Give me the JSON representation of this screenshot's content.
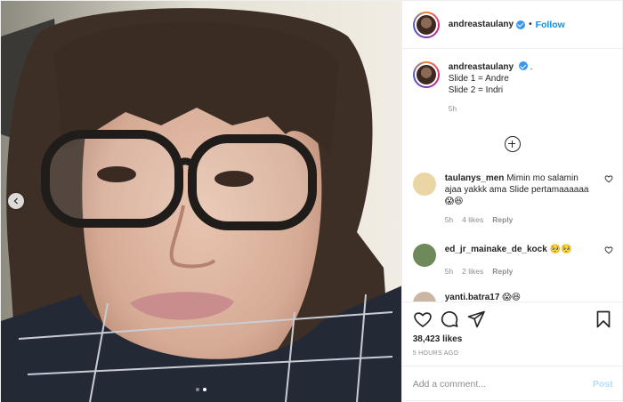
{
  "author": {
    "username": "andreastaulany",
    "verified": true,
    "follow_label": "Follow",
    "separator": "•"
  },
  "caption": {
    "username": "andreastaulany",
    "text_after_user": ".",
    "lines": [
      "Slide 1 = Andre",
      "Slide 2 = Indri"
    ],
    "time": "5h"
  },
  "comments": [
    {
      "username": "taulanys_men",
      "text": "Mimin mo salamin ajaa yakkk ama Slide pertamaaaaaa😱😆",
      "time": "5h",
      "likes": "4 likes",
      "reply_label": "Reply",
      "avatar_color": "#e9d6a4"
    },
    {
      "username": "ed_jr_mainake_de_kock",
      "text": "🥺🥺",
      "time": "5h",
      "likes": "2 likes",
      "reply_label": "Reply",
      "avatar_color": "#6f8a5a"
    },
    {
      "username": "yanti.batra17",
      "text": "😱😆",
      "avatar_color": "#c9b7a3"
    }
  ],
  "actions": {
    "like_icon": "heart-icon",
    "comment_icon": "comment-icon",
    "share_icon": "share-icon",
    "save_icon": "bookmark-icon",
    "likes_count": "38,423 likes",
    "timestamp": "5 HOURS AGO"
  },
  "composer": {
    "placeholder": "Add a comment...",
    "post_label": "Post"
  },
  "carousel": {
    "slide_count": 2,
    "active_slide": 2
  },
  "colors": {
    "accent": "#0095f6",
    "verified": "#3897f0",
    "post_disabled": "#b3dbff",
    "muted": "#8e8e8e"
  }
}
